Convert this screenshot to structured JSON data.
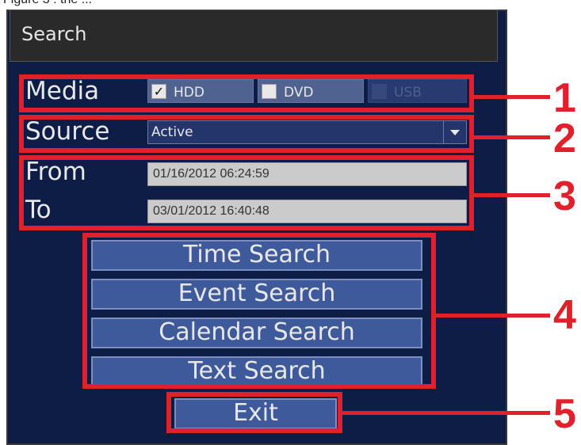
{
  "caption": "Figure 3 : the ...",
  "dialog": {
    "title": "Search",
    "media": {
      "label": "Media",
      "options": [
        {
          "label": "HDD",
          "checked": true,
          "enabled": true
        },
        {
          "label": "DVD",
          "checked": false,
          "enabled": true
        },
        {
          "label": "USB",
          "checked": false,
          "enabled": false
        }
      ]
    },
    "source": {
      "label": "Source",
      "value": "Active"
    },
    "from": {
      "label": "From",
      "value": "01/16/2012 06:24:59"
    },
    "to": {
      "label": "To",
      "value": "03/01/2012 16:40:48"
    },
    "buttons": {
      "time_search": "Time Search",
      "event_search": "Event Search",
      "calendar_search": "Calendar Search",
      "text_search": "Text Search",
      "exit": "Exit"
    }
  },
  "callouts": [
    "1",
    "2",
    "3",
    "4",
    "5"
  ],
  "colors": {
    "dialog_bg": "#0e1d45",
    "button_bg": "#3e5a9a",
    "callout_red": "#e0202a"
  }
}
